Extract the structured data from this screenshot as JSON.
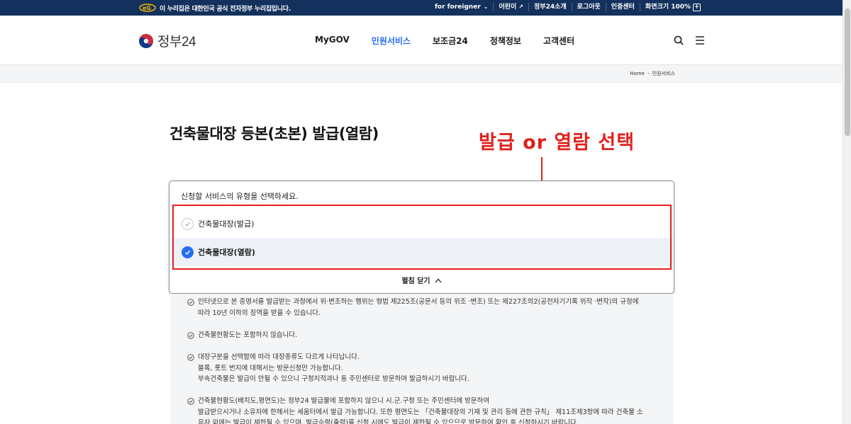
{
  "gov_bar": {
    "notice": "이 누리집은 대한민국 공식 전자정부 누리집입니다.",
    "util": [
      {
        "label": "for foreigner",
        "icon": "chevron-down-icon"
      },
      {
        "label": "어린이",
        "icon": "external-link-icon"
      },
      {
        "label": "정부24소개"
      },
      {
        "label": "로그아웃"
      },
      {
        "label": "인증센터"
      },
      {
        "label": "화면크기"
      }
    ],
    "zoom": "100%"
  },
  "header": {
    "brand": "정부24",
    "nav": [
      {
        "label": "MyGOV",
        "active": false
      },
      {
        "label": "민원서비스",
        "active": true
      },
      {
        "label": "보조금24",
        "active": false
      },
      {
        "label": "정책정보",
        "active": false
      },
      {
        "label": "고객센터",
        "active": false
      }
    ]
  },
  "breadcrumb": {
    "home": "Home",
    "current": "민원서비스"
  },
  "page": {
    "title": "건축물대장 등본(초본) 발급(열람)",
    "annotation": "발급 or 열람 선택"
  },
  "selector": {
    "prompt": "신청할 서비스의 유형을 선택하세요.",
    "options": [
      {
        "label": "건축물대장(발급)",
        "checked": false
      },
      {
        "label": "건축물대장(열람)",
        "checked": true
      }
    ],
    "toggle_label": "펼침 닫기"
  },
  "notices": [
    {
      "lines": [
        "인터넷으로 본 증명서를 발급받는 과정에서 위·변조하는 행위는 형법 제225조(공문서 등의 위조 ·변조) 또는 제227조의2(공전자기기록 위작 ·변작)의 규정에",
        "따라 10년 이하의 징역을 받을 수 있습니다."
      ]
    },
    {
      "lines": [
        "건축물현황도는 포함하지 않습니다."
      ]
    },
    {
      "lines": [
        "대장구분을 선택함에 따라 대장종류도 다르게 나타납니다.",
        "블록, 롯트 번지에 대해서는 방문신청만 가능합니다.",
        "부속건축물은 발급이 안될 수 있으니 구청지적과나 동 주민센터로 방문하여 발급하시기 바랍니다."
      ]
    },
    {
      "lines": [
        "건축물현황도(배치도,평면도)는 정부24 발급물에 포함하지 않으니 시.군.구청 또는 주민센터에 방문하여",
        "발급받으시거나 소유자에 한해서는 세움터에서 발급 가능합니다. 또한 평면도는 「건축물대장의 기재 및 관리 등에 관한 규칙」 제11조제3항에 따라 건축물 소",
        "유자 외에는 발급이 제한될 수 있으며, 발급수령(출력)를 신청 시에도 발급이 제한될 수 있으므로 방문하여 확인 후 신청하시기 바랍니다."
      ]
    }
  ],
  "colors": {
    "gov_bar": "#13315c",
    "accent": "#256ef4",
    "annotation": "#e0211c"
  }
}
